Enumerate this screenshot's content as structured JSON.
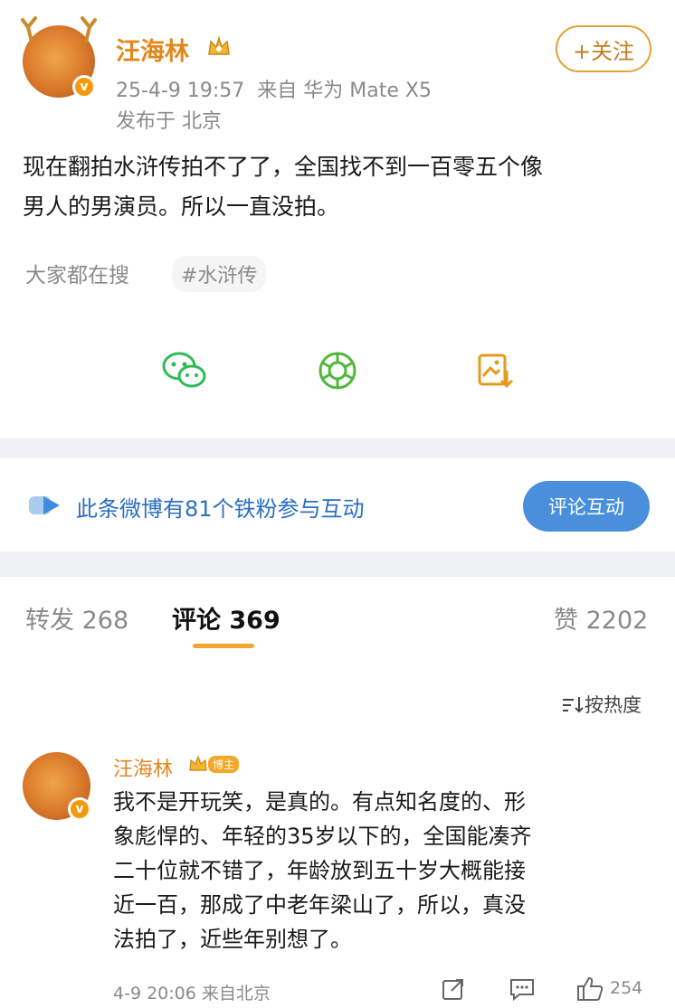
{
  "post": {
    "author": "汪海林",
    "time": "25-4-9 19:57",
    "source": "来自 华为 Mate X5",
    "location": "发布于 北京",
    "follow_label": "+关注",
    "content_line1": "现在翻拍水浒传拍不了了，全国找不到一百零五个像",
    "content_line2": "男人的男演员。所以一直没拍。",
    "search_label": "大家都在搜",
    "tag": "#水浒传"
  },
  "share": {
    "icons": [
      "wechat-icon",
      "moments-icon",
      "save-image-icon"
    ]
  },
  "fans": {
    "text": "此条微博有81个铁粉参与互动",
    "button": "评论互动"
  },
  "tabs": {
    "repost": "转发 268",
    "comment": "评论 369",
    "like": "赞 2202"
  },
  "sort_label": "按热度",
  "comment": {
    "author": "汪海林",
    "badge": "博主",
    "lines": [
      "我不是开玩笑，是真的。有点知名度的、形",
      "象彪悍的、年轻的35岁以下的，全国能凑齐",
      "二十位就不错了，年龄放到五十岁大概能接",
      "近一百，那成了中老年梁山了，所以，真没",
      "法拍了，近些年别想了。"
    ],
    "time_source": "4-9 20:06  来自北京",
    "likes": "254"
  },
  "colors": {
    "accent_orange": "#e2871c",
    "link_blue": "#2a6fc4",
    "button_blue": "#4a8fdb"
  }
}
